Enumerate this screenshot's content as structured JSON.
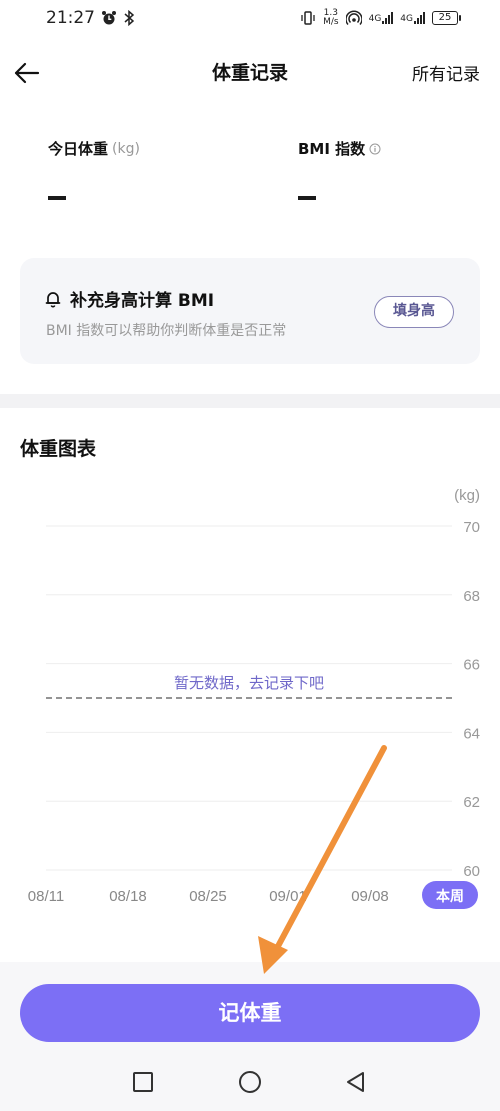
{
  "status_bar": {
    "time": "21:27",
    "net_speed_value": "1.3",
    "net_speed_unit": "M/s",
    "sim1": "4G",
    "sim2": "4G",
    "battery": "25"
  },
  "header": {
    "title": "体重记录",
    "all_records": "所有记录"
  },
  "stats": {
    "weight_label": "今日体重",
    "weight_unit": "(kg)",
    "weight_value": "-",
    "bmi_label": "BMI 指数",
    "bmi_value": "-"
  },
  "bmi_card": {
    "title": "补充身高计算 BMI",
    "description": "BMI 指数可以帮助你判断体重是否正常",
    "button_label": "填身高"
  },
  "chart_section": {
    "title": "体重图表"
  },
  "chart_data": {
    "type": "line",
    "title": "",
    "ylabel": "(kg)",
    "xlabel": "",
    "categories": [
      "08/11",
      "08/18",
      "08/25",
      "09/01",
      "09/08",
      "本周"
    ],
    "yticks": [
      60,
      62,
      64,
      66,
      68,
      70
    ],
    "ylim": [
      60,
      70
    ],
    "grid": true,
    "series": [],
    "reference_line": 65,
    "empty_message": "暂无数据，去记录下吧",
    "highlighted_category": "本周",
    "accent_color": "#7c6ff5"
  },
  "action": {
    "record_button": "记体重"
  },
  "colors": {
    "accent": "#7c6ff5",
    "arrow": "#f0913a"
  }
}
